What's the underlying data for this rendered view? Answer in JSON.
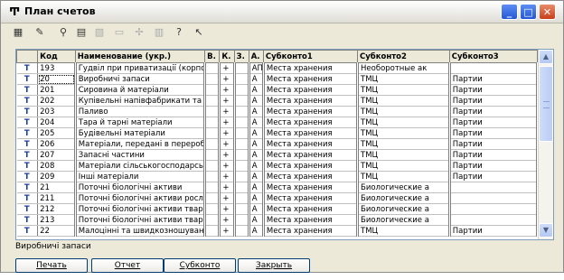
{
  "window": {
    "title": "План счетов",
    "title_icon": "tree-icon"
  },
  "toolbar": {
    "icons": [
      "table-icon",
      "edit-icon",
      "search-icon",
      "new-icon",
      "copy-icon",
      "folder-icon",
      "move-icon",
      "hierarchy-icon",
      "help-icon",
      "pointer-help-icon"
    ]
  },
  "grid": {
    "columns": [
      "",
      "Код",
      "Наименование (укр.)",
      "В.",
      "К.",
      "З.",
      "А.",
      "Субконто1",
      "Субконто2",
      "Субконто3"
    ],
    "rows": [
      {
        "mark": "Т",
        "code": "193",
        "name": "Гудвіл при приватизації (корпорати",
        "v": "",
        "k": "+",
        "z": "",
        "a": "АП",
        "s1": "Места хранения",
        "s2": "Необоротные ак",
        "s3": ""
      },
      {
        "mark": "Т",
        "code": "20",
        "name": "Виробничі запаси",
        "v": "",
        "k": "+",
        "z": "",
        "a": "А",
        "s1": "Места хранения",
        "s2": "ТМЦ",
        "s3": "Партии"
      },
      {
        "mark": "Т",
        "code": "201",
        "name": "Сировина й матеріали",
        "v": "",
        "k": "+",
        "z": "",
        "a": "А",
        "s1": "Места хранения",
        "s2": "ТМЦ",
        "s3": "Партии"
      },
      {
        "mark": "Т",
        "code": "202",
        "name": "Купівельні напівфабрикати та комг",
        "v": "",
        "k": "+",
        "z": "",
        "a": "А",
        "s1": "Места хранения",
        "s2": "ТМЦ",
        "s3": "Партии"
      },
      {
        "mark": "Т",
        "code": "203",
        "name": "Паливо",
        "v": "",
        "k": "+",
        "z": "",
        "a": "А",
        "s1": "Места хранения",
        "s2": "ТМЦ",
        "s3": "Партии"
      },
      {
        "mark": "Т",
        "code": "204",
        "name": "Тара й тарні матеріали",
        "v": "",
        "k": "+",
        "z": "",
        "a": "А",
        "s1": "Места хранения",
        "s2": "ТМЦ",
        "s3": "Партии"
      },
      {
        "mark": "Т",
        "code": "205",
        "name": "Будівельні матеріали",
        "v": "",
        "k": "+",
        "z": "",
        "a": "А",
        "s1": "Места хранения",
        "s2": "ТМЦ",
        "s3": "Партии"
      },
      {
        "mark": "Т",
        "code": "206",
        "name": "Матеріали, передані в переробку",
        "v": "",
        "k": "+",
        "z": "",
        "a": "А",
        "s1": "Места хранения",
        "s2": "ТМЦ",
        "s3": "Партии"
      },
      {
        "mark": "Т",
        "code": "207",
        "name": "Запасні частини",
        "v": "",
        "k": "+",
        "z": "",
        "a": "А",
        "s1": "Места хранения",
        "s2": "ТМЦ",
        "s3": "Партии"
      },
      {
        "mark": "Т",
        "code": "208",
        "name": "Матеріали сільськогосподарського",
        "v": "",
        "k": "+",
        "z": "",
        "a": "А",
        "s1": "Места хранения",
        "s2": "ТМЦ",
        "s3": "Партии"
      },
      {
        "mark": "Т",
        "code": "209",
        "name": "Інші матеріали",
        "v": "",
        "k": "+",
        "z": "",
        "a": "А",
        "s1": "Места хранения",
        "s2": "ТМЦ",
        "s3": "Партии"
      },
      {
        "mark": "Т",
        "code": "21",
        "name": "Поточні біологічні активи",
        "v": "",
        "k": "+",
        "z": "",
        "a": "А",
        "s1": "Места хранения",
        "s2": "Биологические а",
        "s3": ""
      },
      {
        "mark": "Т",
        "code": "211",
        "name": "Поточні біологічні активи рослин., я",
        "v": "",
        "k": "+",
        "z": "",
        "a": "А",
        "s1": "Места хранения",
        "s2": "Биологические а",
        "s3": ""
      },
      {
        "mark": "Т",
        "code": "212",
        "name": "Поточні біологічні активи твар., які",
        "v": "",
        "k": "+",
        "z": "",
        "a": "А",
        "s1": "Места хранения",
        "s2": "Биологические а",
        "s3": ""
      },
      {
        "mark": "Т",
        "code": "213",
        "name": "Поточні біологічні активи твар., які",
        "v": "",
        "k": "+",
        "z": "",
        "a": "А",
        "s1": "Места хранения",
        "s2": "Биологические а",
        "s3": ""
      },
      {
        "mark": "Т",
        "code": "22",
        "name": "Малоцінні та швидкозношувані пред",
        "v": "",
        "k": "+",
        "z": "",
        "a": "А",
        "s1": "Места хранения",
        "s2": "ТМЦ",
        "s3": "Партии"
      }
    ]
  },
  "status_text": "Виробничі запаси",
  "buttons": {
    "print": "Печать",
    "report": "Отчет",
    "subconto": "Субконто",
    "close": "Закрыть"
  },
  "colors": {
    "window_bg": "#ece9d8",
    "row_marker": "#1a3ea7"
  }
}
